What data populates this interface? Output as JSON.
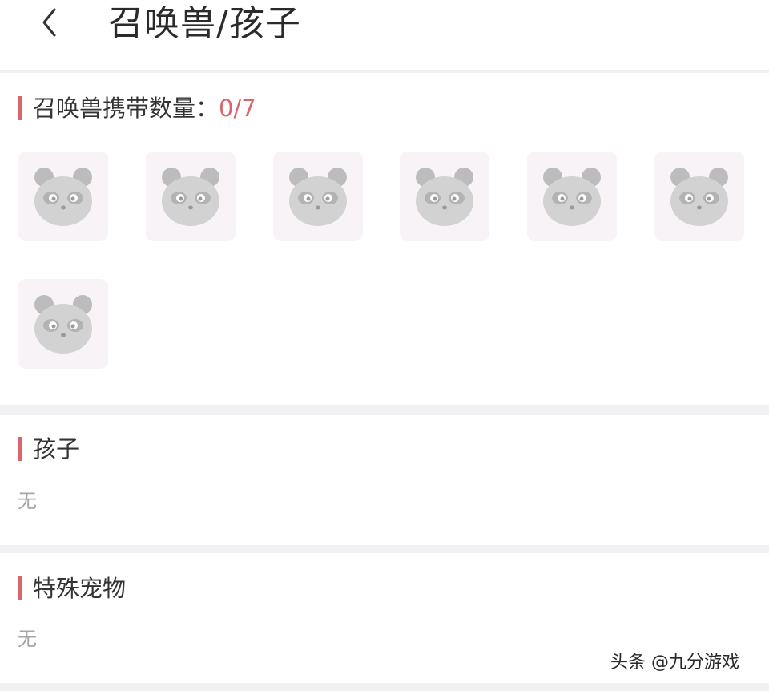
{
  "header": {
    "title": "召唤兽/孩子",
    "back_icon": "chevron-left-icon"
  },
  "summons": {
    "label": "召唤兽携带数量：",
    "count": "0/7",
    "slots": [
      {
        "icon": "panda-placeholder-icon"
      },
      {
        "icon": "panda-placeholder-icon"
      },
      {
        "icon": "panda-placeholder-icon"
      },
      {
        "icon": "panda-placeholder-icon"
      },
      {
        "icon": "panda-placeholder-icon"
      },
      {
        "icon": "panda-placeholder-icon"
      },
      {
        "icon": "panda-placeholder-icon"
      }
    ]
  },
  "children": {
    "label": "孩子",
    "value": "无"
  },
  "special_pets": {
    "label": "特殊宠物",
    "value": "无"
  },
  "watermark": "头条 @九分游戏",
  "colors": {
    "accent": "#d9666c",
    "slot_bg": "#f8f3f6",
    "page_bg": "#f1f1f3",
    "muted_text": "#a6a6a6"
  }
}
